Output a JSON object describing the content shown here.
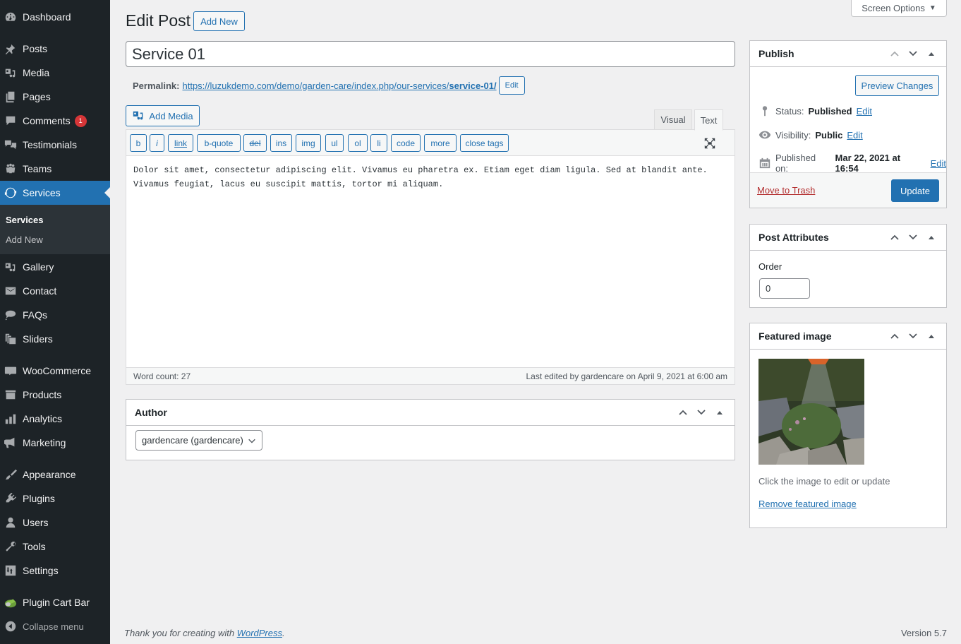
{
  "sidebar": {
    "items": [
      {
        "label": "Dashboard",
        "icon": "dashboard-icon"
      },
      {
        "label": "Posts",
        "icon": "pin-icon"
      },
      {
        "label": "Media",
        "icon": "media-icon"
      },
      {
        "label": "Pages",
        "icon": "pages-icon"
      },
      {
        "label": "Comments",
        "icon": "comment-icon",
        "badge": "1"
      },
      {
        "label": "Testimonials",
        "icon": "testimonial-icon"
      },
      {
        "label": "Teams",
        "icon": "groups-icon"
      },
      {
        "label": "Services",
        "icon": "update-icon",
        "active": true
      },
      {
        "label": "Gallery",
        "icon": "media-icon"
      },
      {
        "label": "Contact",
        "icon": "email-icon"
      },
      {
        "label": "FAQs",
        "icon": "format-chat-icon"
      },
      {
        "label": "Sliders",
        "icon": "slides-icon"
      },
      {
        "label": "WooCommerce",
        "icon": "woo-icon"
      },
      {
        "label": "Products",
        "icon": "archive-icon"
      },
      {
        "label": "Analytics",
        "icon": "chart-bar-icon"
      },
      {
        "label": "Marketing",
        "icon": "megaphone-icon"
      },
      {
        "label": "Appearance",
        "icon": "brush-icon"
      },
      {
        "label": "Plugins",
        "icon": "plugin-icon"
      },
      {
        "label": "Users",
        "icon": "user-icon"
      },
      {
        "label": "Tools",
        "icon": "wrench-icon"
      },
      {
        "label": "Settings",
        "icon": "settings-icon"
      },
      {
        "label": "Plugin Cart Bar",
        "icon": "cart-bar-icon"
      }
    ],
    "submenu": [
      "Services",
      "Add New"
    ],
    "collapse_label": "Collapse menu"
  },
  "header": {
    "title": "Edit Post",
    "add_new_label": "Add New",
    "screen_options_label": "Screen Options"
  },
  "post": {
    "title": "Service 01",
    "permalink_label": "Permalink:",
    "permalink_base": "https://luzukdemo.com/demo/garden-care/index.php/our-services/",
    "permalink_slug": "service-01/",
    "permalink_edit": "Edit"
  },
  "editor": {
    "add_media_label": "Add Media",
    "tabs": [
      "Visual",
      "Text"
    ],
    "active_tab": "Text",
    "quicktags": [
      "b",
      "i",
      "link",
      "b-quote",
      "del",
      "ins",
      "img",
      "ul",
      "ol",
      "li",
      "code",
      "more",
      "close tags"
    ],
    "content": "Dolor sit amet, consectetur adipiscing elit. Vivamus eu pharetra ex. Etiam eget diam ligula. Sed at blandit ante.\nVivamus feugiat, lacus eu suscipit mattis, tortor mi aliquam.",
    "word_count": "Word count: 27",
    "last_edited": "Last edited by gardencare on April 9, 2021 at 6:00 am"
  },
  "author_box": {
    "title": "Author",
    "selected": "gardencare (gardencare)"
  },
  "publish": {
    "title": "Publish",
    "preview_label": "Preview Changes",
    "status_label": "Status:",
    "status_value": "Published",
    "visibility_label": "Visibility:",
    "visibility_value": "Public",
    "published_label": "Published on:",
    "published_value": "Mar 22, 2021 at 16:54",
    "edit_label": "Edit",
    "trash_label": "Move to Trash",
    "update_label": "Update"
  },
  "attributes": {
    "title": "Post Attributes",
    "order_label": "Order",
    "order_value": "0"
  },
  "featured": {
    "title": "Featured image",
    "hint": "Click the image to edit or update",
    "remove_label": "Remove featured image"
  },
  "footer": {
    "thanks_prefix": "Thank you for creating with ",
    "wp_link": "WordPress",
    "thanks_suffix": ".",
    "version": "Version 5.7"
  }
}
